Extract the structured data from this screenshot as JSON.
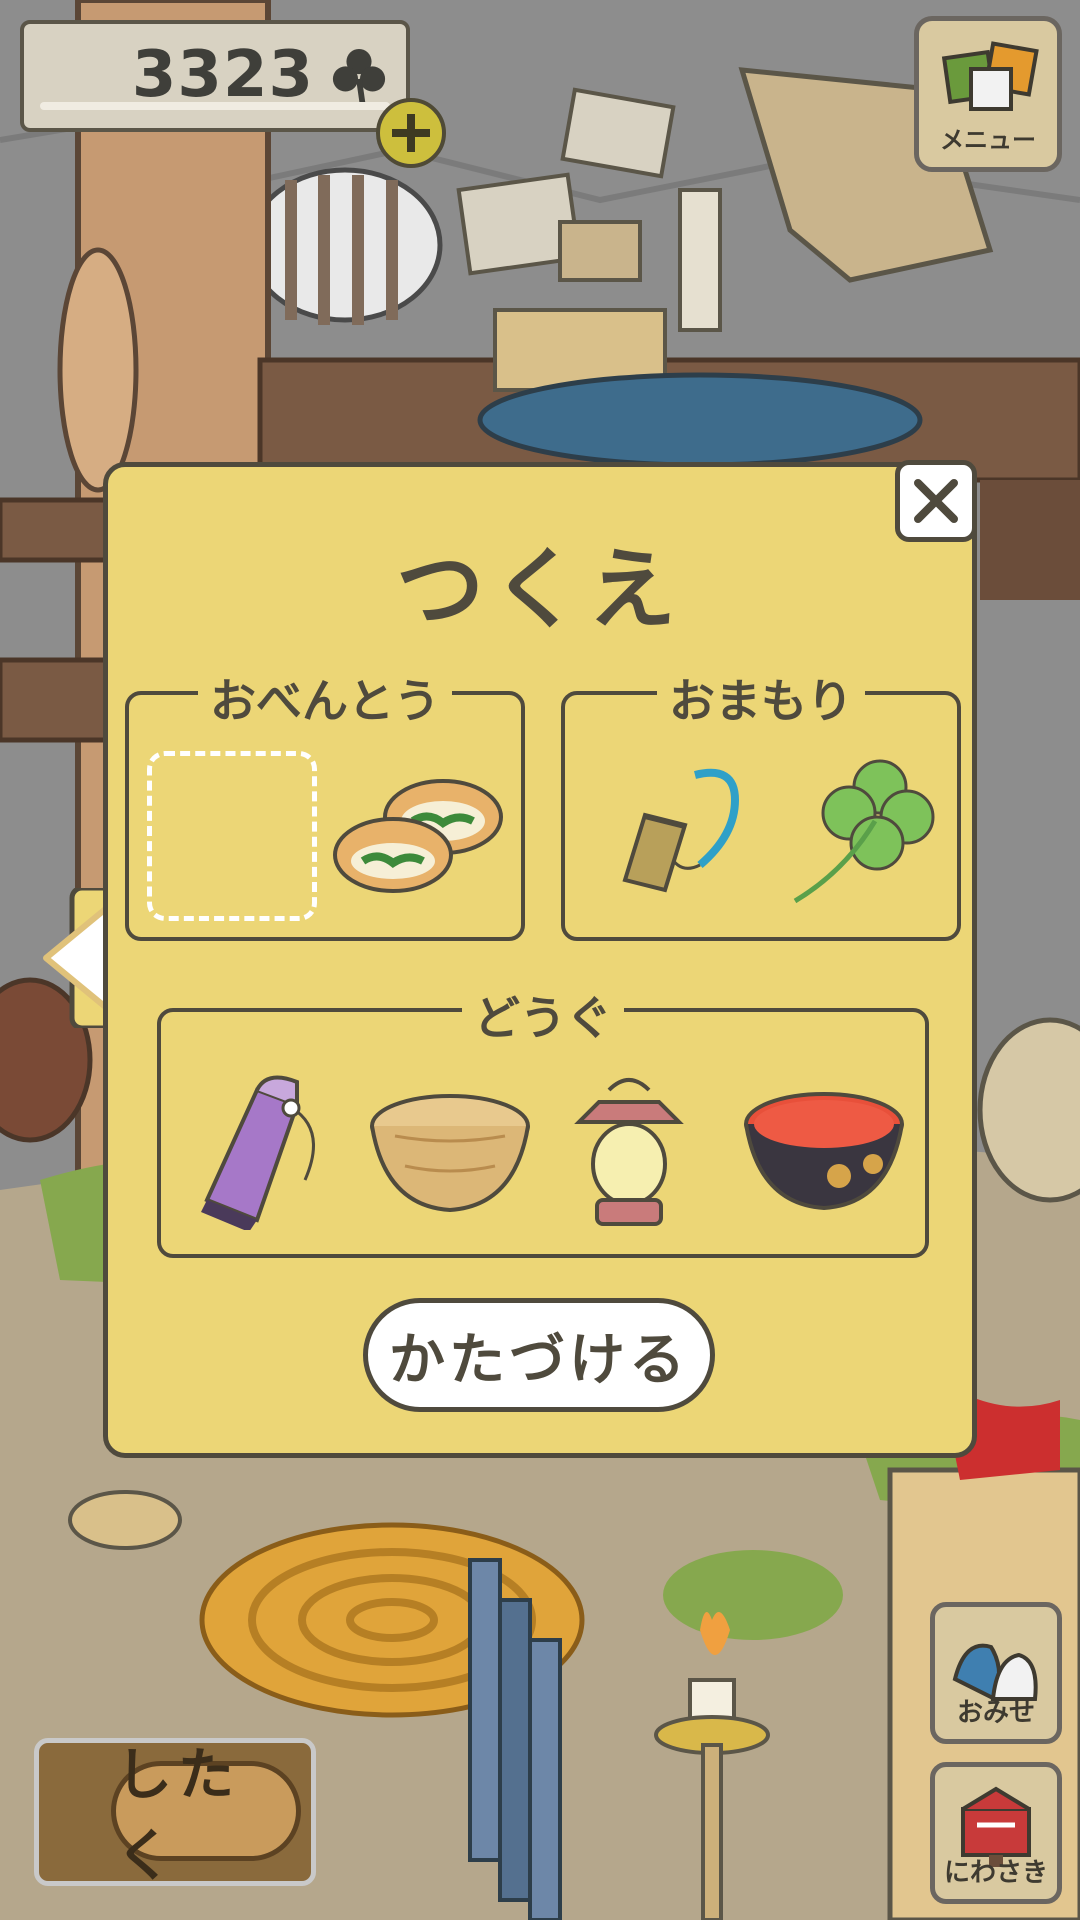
{
  "currency": {
    "clover_count": "3323"
  },
  "menu": {
    "label": "メニュー"
  },
  "panel": {
    "title": "つくえ",
    "groups": {
      "bento": {
        "label": "おべんとう",
        "items": [
          "empty-slot",
          "bread-sandwich"
        ]
      },
      "charm": {
        "label": "おまもり",
        "items": [
          "bell-charm",
          "four-leaf-clover"
        ]
      },
      "tools": {
        "label": "どうぐ",
        "items": [
          "purple-bottle-bag",
          "wooden-bowl",
          "lantern",
          "red-lacquer-bowl"
        ]
      }
    },
    "tidy_button": "かたづける"
  },
  "prepare_button": "したく",
  "shop_button": "おみせ",
  "garden_button": "にわさき",
  "colors": {
    "panel": "#ecd676",
    "panel_border": "#4f4a3d",
    "button_wood": "#d9c9a0"
  }
}
